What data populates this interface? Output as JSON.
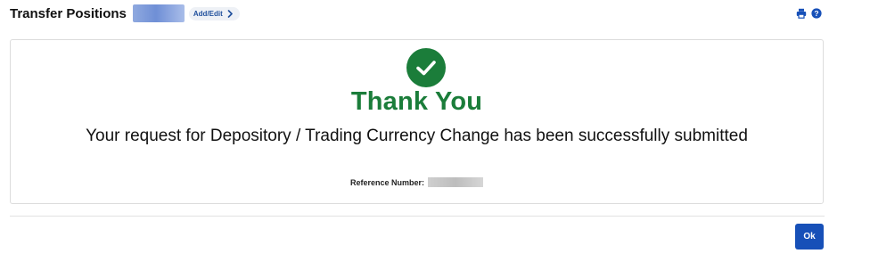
{
  "header": {
    "title": "Transfer Positions",
    "add_edit_label": "Add/Edit",
    "icons": [
      "print-icon",
      "help-icon"
    ],
    "accent_color": "#1750b8"
  },
  "confirmation": {
    "icon": "checkmark-icon",
    "heading": "Thank You",
    "message": "Your request for Depository / Trading Currency Change has been successfully submitted",
    "reference_label": "Reference Number:",
    "success_color": "#1b7d3a"
  },
  "footer": {
    "ok_label": "Ok"
  }
}
